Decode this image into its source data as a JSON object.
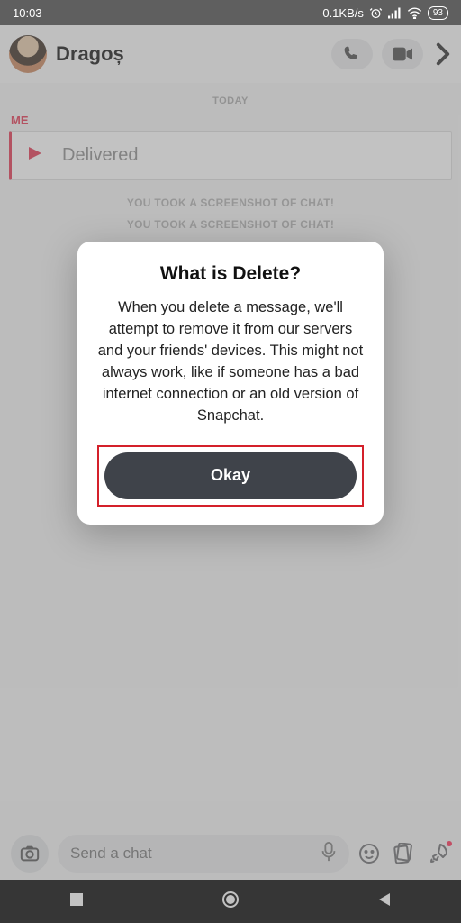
{
  "statusbar": {
    "time": "10:03",
    "net_rate": "0.1KB/s",
    "battery": "93"
  },
  "header": {
    "contact_name": "Dragoș"
  },
  "chat": {
    "date_separator": "TODAY",
    "me_label": "ME",
    "message_status": "Delivered",
    "system_msg_1": "YOU TOOK A SCREENSHOT OF CHAT!",
    "system_msg_2": "YOU TOOK A SCREENSHOT OF CHAT!"
  },
  "composer": {
    "placeholder": "Send a chat"
  },
  "dialog": {
    "title": "What is Delete?",
    "body": "When you delete a message, we'll attempt to remove it from our servers and your friends' devices. This might not always work, like if someone has a bad internet connection or an old version of Snapchat.",
    "ok_label": "Okay"
  }
}
